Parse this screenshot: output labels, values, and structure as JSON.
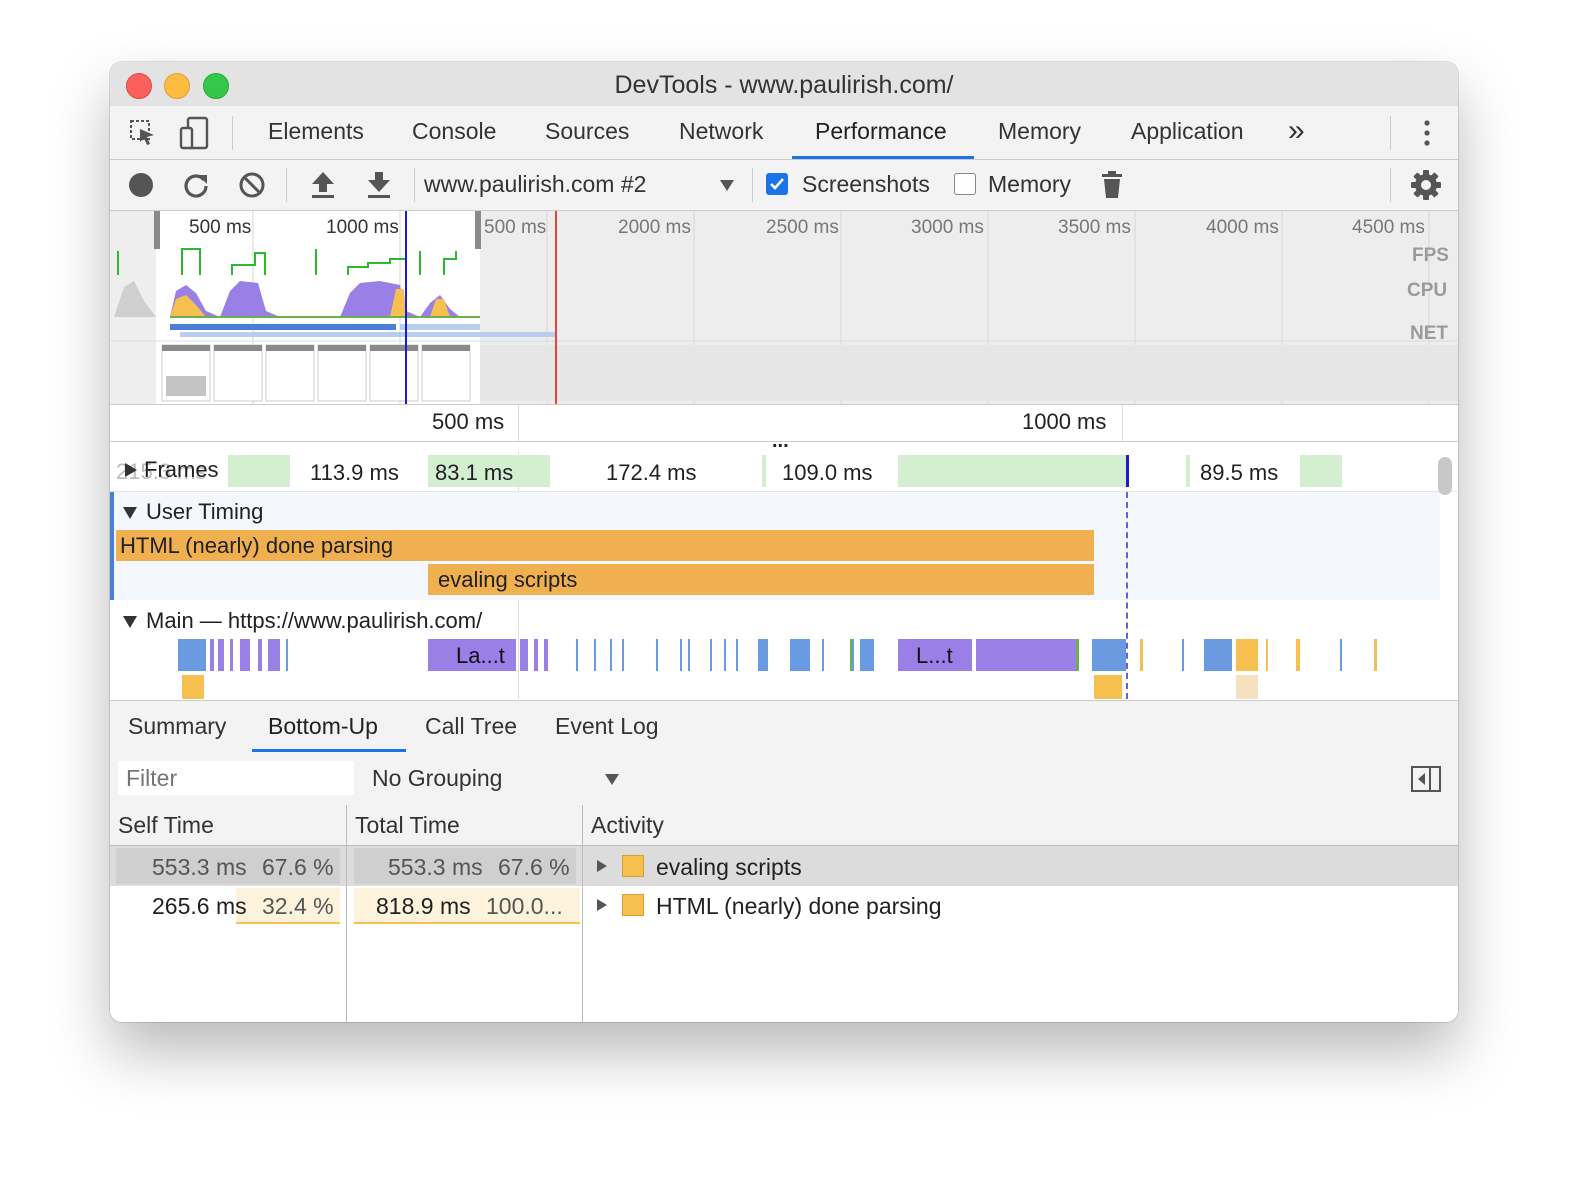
{
  "window": {
    "title": "DevTools - www.paulirish.com/",
    "traffic": {
      "close": "#fc605c",
      "minimize": "#fdbc40",
      "maximize": "#34c84a"
    }
  },
  "icons": {
    "inspect": "select-element-icon",
    "device": "device-toolbar-icon",
    "more_tabs": "double-chevron-icon",
    "kebab": "vertical-dots-icon",
    "record": "record-icon",
    "reload": "reload-icon",
    "clear": "clear-icon",
    "upload": "upload-icon",
    "download": "download-icon",
    "dropdown": "triangle-down-icon",
    "trash": "trash-icon",
    "settings": "gear-icon",
    "sidebar": "sidebar-toggle-icon",
    "expand": "triangle-right-icon",
    "collapse": "triangle-down-icon"
  },
  "tabs": [
    "Elements",
    "Console",
    "Sources",
    "Network",
    "Performance",
    "Memory",
    "Application"
  ],
  "active_tab": "Performance",
  "more_tabs": "»",
  "toolbar": {
    "profile_select": "www.paulirish.com #2",
    "screenshots_label": "Screenshots",
    "screenshots_checked": true,
    "memory_label": "Memory",
    "memory_checked": false
  },
  "overview": {
    "ticks": [
      "500 ms",
      "1000 ms",
      "500 ms",
      "2000 ms",
      "2500 ms",
      "3000 ms",
      "3500 ms",
      "4000 ms",
      "4500 ms"
    ],
    "lane_labels": [
      "FPS",
      "CPU",
      "NET"
    ]
  },
  "timeline_ruler": {
    "ticks": [
      "500 ms",
      "1000 ms"
    ],
    "more": "..."
  },
  "frames": {
    "label": "Frames",
    "ghost": "215.3 ms",
    "durations": [
      "113.9 ms",
      "83.1 ms",
      "172.4 ms",
      "109.0 ms",
      "89.5 ms"
    ]
  },
  "user_timing": {
    "label": "User Timing",
    "marks": [
      "HTML (nearly) done parsing",
      "evaling scripts"
    ]
  },
  "main_thread": {
    "label": "Main — https://www.paulirish.com/",
    "events": [
      "La...t",
      "L...t"
    ]
  },
  "lower_tabs": [
    "Summary",
    "Bottom-Up",
    "Call Tree",
    "Event Log"
  ],
  "active_lower_tab": "Bottom-Up",
  "filter": {
    "placeholder": "Filter",
    "grouping": "No Grouping"
  },
  "table": {
    "columns": [
      "Self Time",
      "Total Time",
      "Activity"
    ],
    "rows": [
      {
        "self_time": "553.3 ms",
        "self_pct": "67.6 %",
        "total_time": "553.3 ms",
        "total_pct": "67.6 %",
        "activity": "evaling scripts",
        "swatch": "#f5c050"
      },
      {
        "self_time": "265.6 ms",
        "self_pct": "32.4 %",
        "total_time": "818.9 ms",
        "total_pct": "100.0...",
        "activity": "HTML (nearly) done parsing",
        "swatch": "#f5c050"
      }
    ]
  }
}
